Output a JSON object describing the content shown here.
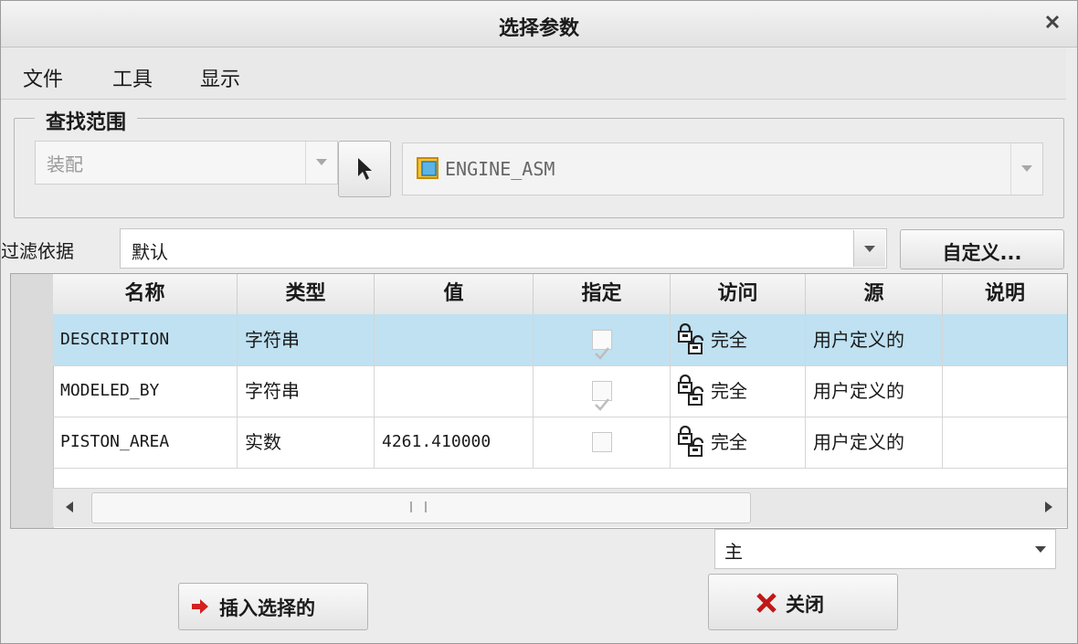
{
  "window": {
    "title": "选择参数"
  },
  "menu": [
    "文件",
    "工具",
    "显示"
  ],
  "scope": {
    "legend": "查找范围",
    "type_value": "装配",
    "model_value": "ENGINE_ASM"
  },
  "filter": {
    "label": "过滤依据",
    "value": "默认",
    "customize_label": "自定义..."
  },
  "table": {
    "headers": [
      "名称",
      "类型",
      "值",
      "指定",
      "访问",
      "源",
      "说明"
    ],
    "rows": [
      {
        "name": "DESCRIPTION",
        "type": "字符串",
        "value": "",
        "designated": true,
        "access": "完全",
        "source": "用户定义的",
        "description": "",
        "selected": true
      },
      {
        "name": "MODELED_BY",
        "type": "字符串",
        "value": "",
        "designated": true,
        "access": "完全",
        "source": "用户定义的",
        "description": "",
        "selected": false
      },
      {
        "name": "PISTON_AREA",
        "type": "实数",
        "value": "4261.410000",
        "designated": false,
        "access": "完全",
        "source": "用户定义的",
        "description": "",
        "selected": false
      }
    ]
  },
  "bottom_select": {
    "value": "主"
  },
  "buttons": {
    "insert_label": "插入选择的",
    "close_label": "关闭"
  },
  "colors": {
    "selected_row": "#bfe1f1",
    "insert_arrow": "#d42020",
    "close_x": "#c01818"
  }
}
